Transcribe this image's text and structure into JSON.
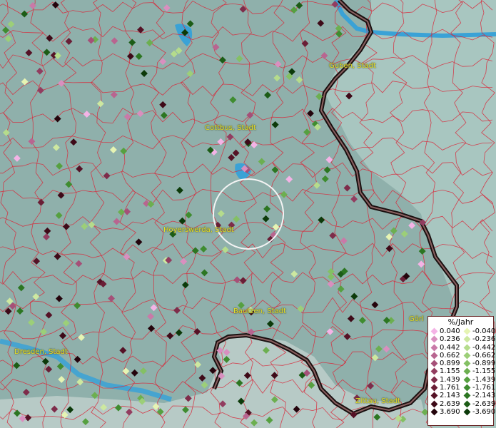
{
  "map": {
    "cities": [
      {
        "id": "guben",
        "label": "Guben, Stadt"
      },
      {
        "id": "cottbus",
        "label": "Cottbus, Stadt"
      },
      {
        "id": "hoyerswerda",
        "label": "Hoyerswerda, Stadt"
      },
      {
        "id": "bautzen",
        "label": "Bautzen, Stadt"
      },
      {
        "id": "goerlitz",
        "label": "Görl"
      },
      {
        "id": "dresden",
        "label": "Dresden, Stadt"
      },
      {
        "id": "zittau",
        "label": "Zittau, Stadt"
      }
    ]
  },
  "legend": {
    "title": "%/Jahr",
    "rows": [
      {
        "pos": "0.040",
        "neg": "-0.040",
        "pcolor": "#f4b3e6",
        "ncolor": "#e6f4b3"
      },
      {
        "pos": "0.236",
        "neg": "-0.236",
        "pcolor": "#d98fbf",
        "ncolor": "#cde8a0"
      },
      {
        "pos": "0.442",
        "neg": "-0.442",
        "pcolor": "#c97aa8",
        "ncolor": "#b5dc8c"
      },
      {
        "pos": "0.662",
        "neg": "-0.662",
        "pcolor": "#b86590",
        "ncolor": "#9ccf78"
      },
      {
        "pos": "0.899",
        "neg": "-0.899",
        "pcolor": "#a55078",
        "ncolor": "#84c064"
      },
      {
        "pos": "1.155",
        "neg": "-1.155",
        "pcolor": "#923d60",
        "ncolor": "#6caf50"
      },
      {
        "pos": "1.439",
        "neg": "-1.439",
        "pcolor": "#7e2c4a",
        "ncolor": "#56a040"
      },
      {
        "pos": "1.761",
        "neg": "-1.761",
        "pcolor": "#6a1e36",
        "ncolor": "#3f8c30"
      },
      {
        "pos": "2.143",
        "neg": "-2.143",
        "pcolor": "#551226",
        "ncolor": "#2c7622"
      },
      {
        "pos": "2.639",
        "neg": "-2.639",
        "pcolor": "#3e0a18",
        "ncolor": "#1c5c16"
      },
      {
        "pos": "3.690",
        "neg": "-3.690",
        "pcolor": "#24040c",
        "ncolor": "#0c3a0a"
      }
    ]
  }
}
